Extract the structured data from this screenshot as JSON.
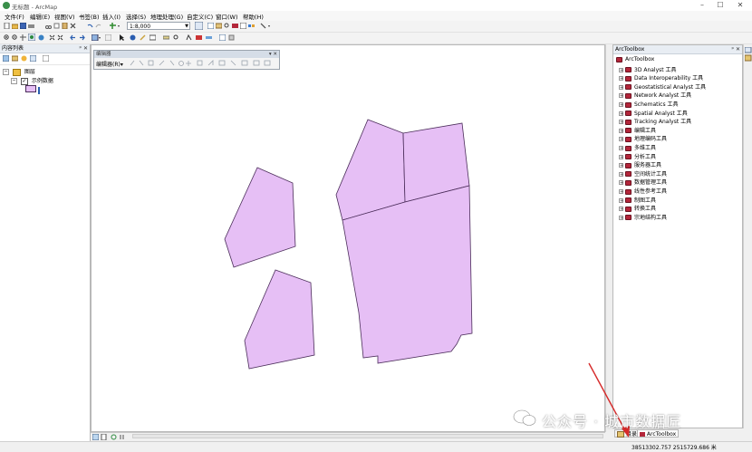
{
  "window": {
    "title": "无标题 - ArcMap"
  },
  "menu": [
    "文件(F)",
    "编辑(E)",
    "视图(V)",
    "书签(B)",
    "插入(I)",
    "选择(S)",
    "地理处理(G)",
    "自定义(C)",
    "窗口(W)",
    "帮助(H)"
  ],
  "toolbar": {
    "scale": "1:8,000"
  },
  "toc": {
    "title": "内容列表",
    "root_label": "图层",
    "layer_label": "示例数据"
  },
  "editor": {
    "title": "编辑器",
    "menu_label": "编辑器(R)▾"
  },
  "arctoolbox": {
    "title": "ArcToolbox",
    "root": "ArcToolbox",
    "items": [
      "3D Analyst 工具",
      "Data Interoperability 工具",
      "Geostatistical Analyst 工具",
      "Network Analyst 工具",
      "Schematics 工具",
      "Spatial Analyst 工具",
      "Tracking Analyst 工具",
      "编辑工具",
      "地理编码工具",
      "多维工具",
      "分析工具",
      "服务器工具",
      "空间统计工具",
      "数据管理工具",
      "线性参考工具",
      "制图工具",
      "转换工具",
      "宗地结构工具"
    ]
  },
  "bottom_tabs": {
    "catalog": "目录",
    "arctoolbox": "ArcToolbox"
  },
  "status": {
    "coordinates": "38513302.757  2515729.686 米"
  },
  "watermark": {
    "text": "公众号 · 城市数据匠"
  },
  "colors": {
    "polygon_fill": "#e6bff5",
    "polygon_stroke": "#4b2d5a",
    "arrow": "#d62a2a"
  }
}
